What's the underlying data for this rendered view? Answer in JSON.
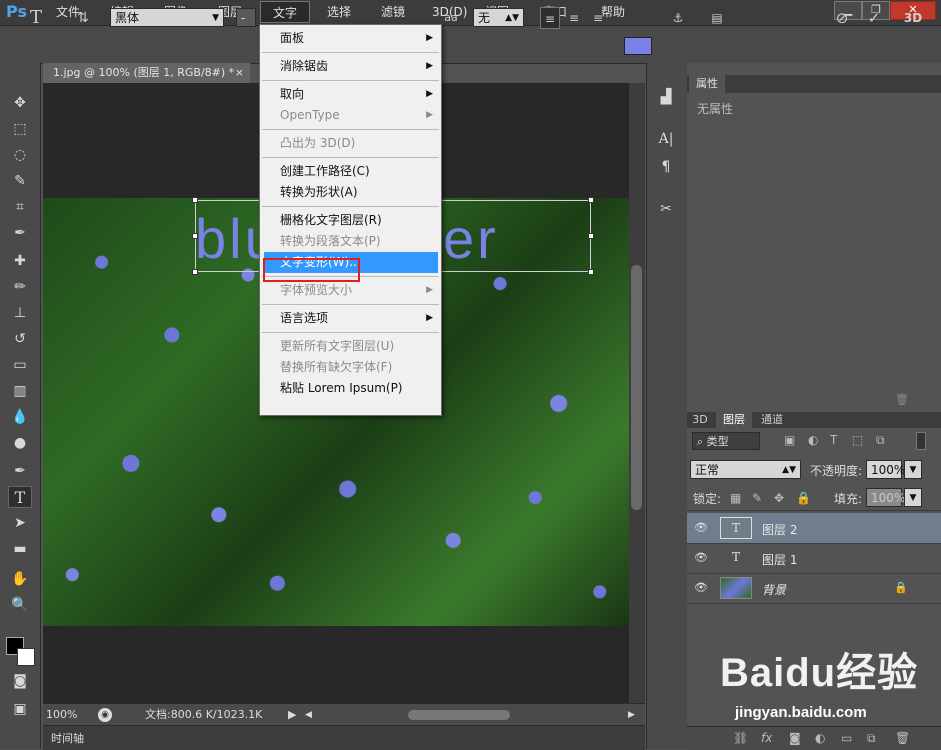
{
  "app": {
    "logo": "Ps"
  },
  "menubar": {
    "items": [
      "文件(F)",
      "编辑(E)",
      "图像(I)",
      "图层(L)",
      "文字(Y)",
      "选择(S)",
      "滤镜(T)",
      "3D(D)",
      "视图(V)",
      "窗口(W)",
      "帮助(H)"
    ],
    "active_index": 4,
    "window_controls": {
      "minimize": "▁",
      "restore": "❐",
      "close": "✕"
    }
  },
  "options_bar": {
    "font_family": "黑体",
    "font_style": "-",
    "aa_label": "aa",
    "antialias": "无",
    "orientation_icon": "text-orientation-icon",
    "color_swatch": "#7b82e6",
    "cancel_icon": "cancel-icon",
    "commit_icon": "commit-icon",
    "label_3d": "3D"
  },
  "document": {
    "tab_title": "1.jpg @ 100% (图层 1, RGB/8#) *",
    "close_icon": "×",
    "text_layer_content": "blue flower",
    "text_color": "#7b82e6"
  },
  "type_menu": {
    "items": [
      {
        "label": "面板",
        "submenu": true,
        "disabled": false
      },
      {
        "sep": true
      },
      {
        "label": "消除锯齿",
        "submenu": true,
        "disabled": false
      },
      {
        "sep": true
      },
      {
        "label": "取向",
        "submenu": true,
        "disabled": false
      },
      {
        "label": "OpenType",
        "submenu": true,
        "disabled": true
      },
      {
        "sep": true
      },
      {
        "label": "凸出为 3D(D)",
        "submenu": false,
        "disabled": true
      },
      {
        "sep": true
      },
      {
        "label": "创建工作路径(C)",
        "submenu": false,
        "disabled": false
      },
      {
        "label": "转换为形状(A)",
        "submenu": false,
        "disabled": false
      },
      {
        "sep": true
      },
      {
        "label": "栅格化文字图层(R)",
        "submenu": false,
        "disabled": false
      },
      {
        "label": "转换为段落文本(P)",
        "submenu": false,
        "disabled": true
      },
      {
        "label": "文字变形(W)...",
        "submenu": false,
        "disabled": false,
        "highlight": true
      },
      {
        "sep": true
      },
      {
        "label": "字体预览大小",
        "submenu": true,
        "disabled": true
      },
      {
        "sep": true
      },
      {
        "label": "语言选项",
        "submenu": true,
        "disabled": false
      },
      {
        "sep": true
      },
      {
        "label": "更新所有文字图层(U)",
        "submenu": false,
        "disabled": true
      },
      {
        "label": "替换所有缺欠字体(F)",
        "submenu": false,
        "disabled": true
      },
      {
        "label": "粘贴 Lorem Ipsum(P)",
        "submenu": false,
        "disabled": false
      }
    ]
  },
  "status": {
    "zoom": "100%",
    "doc_info": "文档:800.6 K/1023.1K",
    "timeline_tab": "时间轴"
  },
  "properties_panel": {
    "tab": "属性",
    "empty_text": "无属性"
  },
  "layers_panel": {
    "tabs": [
      "3D",
      "图层",
      "通道"
    ],
    "active_tab": 1,
    "filter_kind": "类型",
    "blend_mode": "正常",
    "opacity_label": "不透明度:",
    "opacity_value": "100%",
    "lock_label": "锁定:",
    "fill_label": "填充:",
    "fill_value": "100%",
    "layers": [
      {
        "name": "图层 2",
        "type": "text",
        "selected": true,
        "thumb": "T"
      },
      {
        "name": "图层 1",
        "type": "text",
        "selected": false,
        "thumb": "T"
      },
      {
        "name": "背景",
        "type": "image",
        "selected": false,
        "thumb": "",
        "locked": true
      }
    ]
  },
  "watermark": {
    "text": "Baidu经验",
    "url": "jingyan.baidu.com"
  }
}
